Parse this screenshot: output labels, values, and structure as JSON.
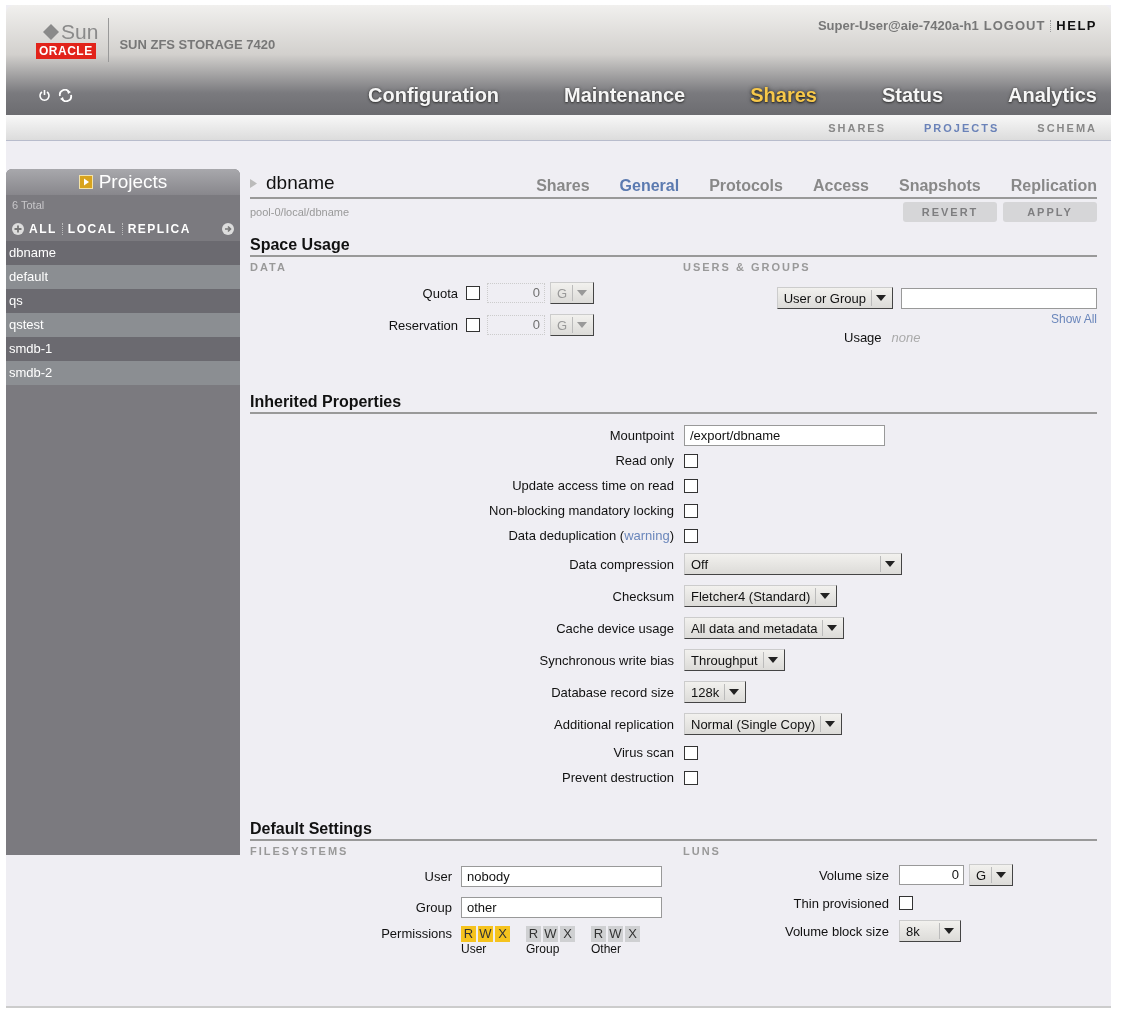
{
  "header": {
    "brand": "Sun",
    "brand_sub": "ORACLE",
    "product": "SUN ZFS STORAGE 7420",
    "user": "Super-User@aie-7420a-h1",
    "logout": "LOGOUT",
    "help": "HELP",
    "nav": [
      {
        "label": "Configuration",
        "selected": false
      },
      {
        "label": "Maintenance",
        "selected": false
      },
      {
        "label": "Shares",
        "selected": true
      },
      {
        "label": "Status",
        "selected": false
      },
      {
        "label": "Analytics",
        "selected": false
      }
    ],
    "subnav": [
      {
        "label": "SHARES",
        "selected": false
      },
      {
        "label": "PROJECTS",
        "selected": true
      },
      {
        "label": "SCHEMA",
        "selected": false
      }
    ]
  },
  "sidebar": {
    "title": "Projects",
    "total": "6 Total",
    "filters": [
      "ALL",
      "LOCAL",
      "REPLICA"
    ],
    "items": [
      "dbname",
      "default",
      "qs",
      "qstest",
      "smdb-1",
      "smdb-2"
    ]
  },
  "project": {
    "name": "dbname",
    "path": "pool-0/local/dbname",
    "tabs": [
      {
        "label": "Shares",
        "selected": false
      },
      {
        "label": "General",
        "selected": true
      },
      {
        "label": "Protocols",
        "selected": false
      },
      {
        "label": "Access",
        "selected": false
      },
      {
        "label": "Snapshots",
        "selected": false
      },
      {
        "label": "Replication",
        "selected": false
      }
    ],
    "buttons": [
      {
        "label": "REVERT",
        "disabled": true
      },
      {
        "label": "APPLY",
        "disabled": true
      }
    ]
  },
  "space_usage": {
    "title": "Space Usage",
    "data_label": "DATA",
    "users_label": "USERS & GROUPS",
    "data_rows": [
      {
        "label": "Quota",
        "checked": false,
        "value": "0",
        "unit": "G"
      },
      {
        "label": "Reservation",
        "checked": false,
        "value": "0",
        "unit": "G"
      }
    ],
    "user_select": "User or Group",
    "show_all": "Show All",
    "usage_label": "Usage",
    "usage_value": "none"
  },
  "inherited": {
    "title": "Inherited Properties",
    "rows": [
      {
        "kind": "text",
        "label": "Mountpoint",
        "value": "/export/dbname"
      },
      {
        "kind": "checkbox",
        "label": "Read only",
        "checked": false
      },
      {
        "kind": "checkbox",
        "label": "Update access time on read",
        "checked": false
      },
      {
        "kind": "checkbox",
        "label": "Non-blocking mandatory locking",
        "checked": false
      },
      {
        "kind": "checkbox",
        "label": "Data deduplication (",
        "link": "warning",
        "label_end": ")",
        "checked": false
      },
      {
        "kind": "select",
        "label": "Data compression",
        "value": "Off"
      },
      {
        "kind": "select",
        "label": "Checksum",
        "value": "Fletcher4 (Standard)"
      },
      {
        "kind": "select",
        "label": "Cache device usage",
        "value": "All data and metadata"
      },
      {
        "kind": "select",
        "label": "Synchronous write bias",
        "value": "Throughput"
      },
      {
        "kind": "select",
        "label": "Database record size",
        "value": "128k"
      },
      {
        "kind": "select",
        "label": "Additional replication",
        "value": "Normal (Single Copy)"
      },
      {
        "kind": "checkbox",
        "label": "Virus scan",
        "checked": false
      },
      {
        "kind": "checkbox",
        "label": "Prevent destruction",
        "checked": false
      }
    ]
  },
  "defaults": {
    "title": "Default Settings",
    "fs_label": "FILESYSTEMS",
    "luns_label": "LUNS",
    "user_label": "User",
    "user": "nobody",
    "group_label": "Group",
    "group": "other",
    "permissions_label": "Permissions",
    "permissions": [
      {
        "label": "User",
        "bits": [
          {
            "letter": "R",
            "on": true
          },
          {
            "letter": "W",
            "on": true
          },
          {
            "letter": "X",
            "on": true
          }
        ]
      },
      {
        "label": "Group",
        "bits": [
          {
            "letter": "R",
            "on": false
          },
          {
            "letter": "W",
            "on": false
          },
          {
            "letter": "X",
            "on": false
          }
        ]
      },
      {
        "label": "Other",
        "bits": [
          {
            "letter": "R",
            "on": false
          },
          {
            "letter": "W",
            "on": false
          },
          {
            "letter": "X",
            "on": false
          }
        ]
      }
    ],
    "volume_size_label": "Volume size",
    "volume_size": "0",
    "volume_unit": "G",
    "thin_label": "Thin provisioned",
    "thin": false,
    "block_label": "Volume block size",
    "block": "8k"
  }
}
